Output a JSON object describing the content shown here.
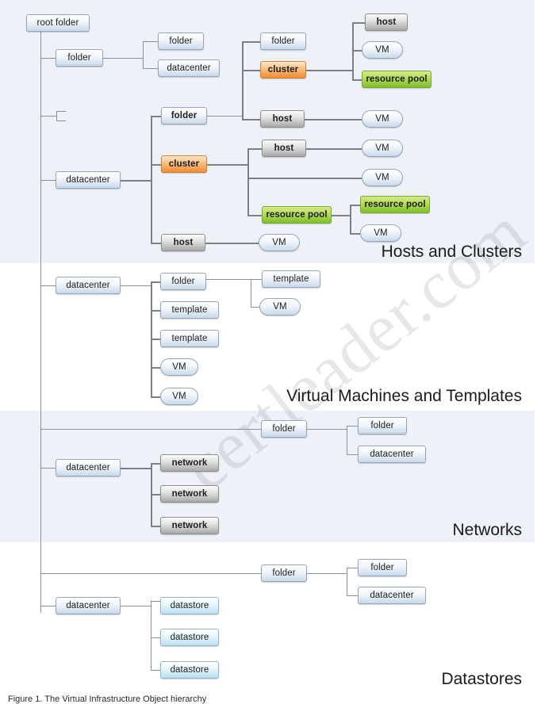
{
  "figure": {
    "caption": "Figure 1.  The Virtual Infrastructure Object hierarchy",
    "watermark": "certleader.com"
  },
  "sections": [
    {
      "id": "hosts-and-clusters",
      "title": "Hosts and Clusters"
    },
    {
      "id": "virtual-machines-templates",
      "title": "Virtual Machines and Templates"
    },
    {
      "id": "networks",
      "title": "Networks"
    },
    {
      "id": "datastores",
      "title": "Datastores"
    }
  ],
  "root": {
    "label": "root folder"
  },
  "labels": {
    "folder": "folder",
    "datacenter": "datacenter",
    "cluster": "cluster",
    "host": "host",
    "vm": "VM",
    "resource_pool": "resource pool",
    "template": "template",
    "network": "network",
    "datastore": "datastore"
  },
  "colors": {
    "band": "#eef1f7",
    "blue_node": "#c9d9ec",
    "gray_node": "#a8a8a8",
    "orange_node": "#ef8b33",
    "green_node": "#7dbe2e",
    "cyan_node": "#b9e0f2",
    "connector": "#8d9099",
    "text": "#1d1d1d"
  },
  "nodes": {
    "hc": {
      "folder_a": "folder",
      "folder_b": "folder",
      "datacenter_a": "datacenter",
      "folder_c": "folder",
      "folder_d": "folder",
      "cluster_a": "cluster",
      "host_a": "host",
      "vm_a": "VM",
      "rp_a": "resource pool",
      "host_b": "host",
      "vm_b": "VM",
      "datacenter_b": "datacenter",
      "cluster_b": "cluster",
      "host_c": "host",
      "vm_c": "VM",
      "vm_d": "VM",
      "rp_b": "resource pool",
      "rp_c": "resource pool",
      "vm_e": "VM",
      "host_d": "host",
      "vm_f": "VM"
    },
    "vmt": {
      "datacenter": "datacenter",
      "folder": "folder",
      "template_in_folder": "template",
      "vm_in_folder": "VM",
      "template_1": "template",
      "template_2": "template",
      "vm_1": "VM",
      "vm_2": "VM"
    },
    "net": {
      "folder_top": "folder",
      "folder_sub": "folder",
      "datacenter_sub": "datacenter",
      "datacenter": "datacenter",
      "network_1": "network",
      "network_2": "network",
      "network_3": "network"
    },
    "ds": {
      "folder_top": "folder",
      "folder_sub": "folder",
      "datacenter_sub": "datacenter",
      "datacenter": "datacenter",
      "datastore_1": "datastore",
      "datastore_2": "datastore",
      "datastore_3": "datastore"
    }
  }
}
